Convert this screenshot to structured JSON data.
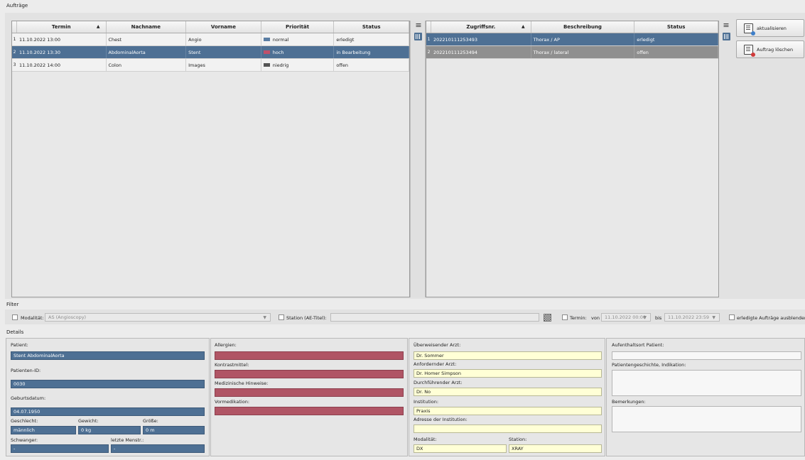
{
  "orders": {
    "title": "Aufträge",
    "columns": [
      "Termin",
      "Nachname",
      "Vorname",
      "Priorität",
      "Status"
    ],
    "rows": [
      {
        "n": "1",
        "termin": "11.10.2022 13:00",
        "nachname": "Chest",
        "vorname": "Angio",
        "prio": "normal",
        "prio_color": "#5a7da3",
        "status": "erledigt"
      },
      {
        "n": "2",
        "termin": "11.10.2022 13:30",
        "nachname": "AbdominalAorta",
        "vorname": "Stent",
        "prio": "hoch",
        "prio_color": "#c0506a",
        "status": "in Bearbeitung"
      },
      {
        "n": "3",
        "termin": "11.10.2022 14:00",
        "nachname": "Colon",
        "vorname": "Images",
        "prio": "niedrig",
        "prio_color": "#555555",
        "status": "offen"
      }
    ]
  },
  "access": {
    "columns": [
      "Zugriffsnr.",
      "Beschreibung",
      "Status"
    ],
    "rows": [
      {
        "n": "1",
        "nr": "202210111253493",
        "desc": "Thorax / AP",
        "status": "erledigt"
      },
      {
        "n": "2",
        "nr": "202210111253494",
        "desc": "Thorax / lateral",
        "status": "offen"
      }
    ]
  },
  "buttons": {
    "refresh": "aktualisieren",
    "delete": "Auftrag löschen"
  },
  "filter": {
    "title": "Filter",
    "modality_label": "Modalität:",
    "modality_value": "AS (Angioscopy)",
    "station_label": "Station (AE-Titel):",
    "station_value": "",
    "termin_label": "Termin:",
    "von_label": "von",
    "von_value": "11.10.2022  00:00",
    "bis_label": "bis",
    "bis_value": "11.10.2022  23:59",
    "hide_done_label": "erledigte Aufträge ausblenden"
  },
  "details": {
    "title": "Details",
    "patient_label": "Patient:",
    "patient_value": "Stent AbdominalAorta",
    "patient_id_label": "Patienten-ID:",
    "patient_id_value": "0030",
    "birth_label": "Geburtsdatum:",
    "birth_value": "04.07.1950",
    "sex_label": "Geschlecht:",
    "sex_value": "männlich",
    "weight_label": "Gewicht:",
    "weight_value": "0 kg",
    "height_label": "Größe:",
    "height_value": "0 m",
    "pregnant_label": "Schwanger:",
    "pregnant_value": "-",
    "menstr_label": "letzte Menstr.:",
    "menstr_value": "-",
    "allergies_label": "Allergien:",
    "contrast_label": "Kontrastmittel:",
    "medical_label": "Medizinische Hinweise:",
    "premed_label": "Vormedikation:",
    "referring_label": "Überweisender Arzt:",
    "referring_value": "Dr. Sommer",
    "requesting_label": "Anfordernder Arzt:",
    "requesting_value": "Dr. Homer Simpson",
    "performing_label": "Durchführender Arzt:",
    "performing_value": "Dr. No",
    "institution_label": "Institution:",
    "institution_value": "Praxis",
    "address_label": "Adresse der Institution:",
    "address_value": "",
    "modality_label": "Modalität:",
    "modality_value": "DX",
    "station_label": "Station:",
    "station_value": "XRAY",
    "location_label": "Aufenthaltsort Patient:",
    "history_label": "Patientengeschichte, Indikation:",
    "remarks_label": "Bemerkungen:"
  }
}
